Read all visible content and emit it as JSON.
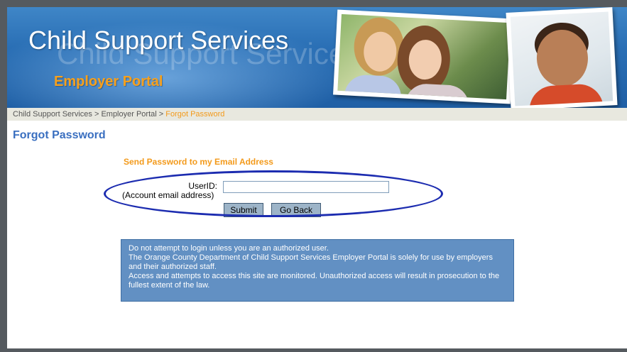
{
  "banner": {
    "title": "Child Support Services",
    "subtitle": "Employer Portal"
  },
  "breadcrumb": {
    "items": [
      "Child Support Services",
      "Employer Portal"
    ],
    "separator": " > ",
    "current": "Forgot Password"
  },
  "page": {
    "heading": "Forgot Password",
    "section_title": "Send Password to my Email Address"
  },
  "form": {
    "userid_label": "UserID:",
    "userid_sublabel": "(Account email address)",
    "userid_value": "",
    "submit_label": "Submit",
    "back_label": "Go Back"
  },
  "notice": {
    "lines": [
      "Do not attempt to login unless you are an authorized user.",
      "The Orange County Department of Child Support Services Employer Portal is solely for use by employers and their authorized staff.",
      "Access and attempts to access this site are monitored. Unauthorized access will result in prosecution to the fullest extent of the law."
    ]
  },
  "colors": {
    "banner_blue": "#2a6fb5",
    "accent_orange": "#f39a1b",
    "heading_blue": "#3a6fc0",
    "notice_bg": "#6290c3",
    "annotation_oval": "#1c2cb0"
  }
}
